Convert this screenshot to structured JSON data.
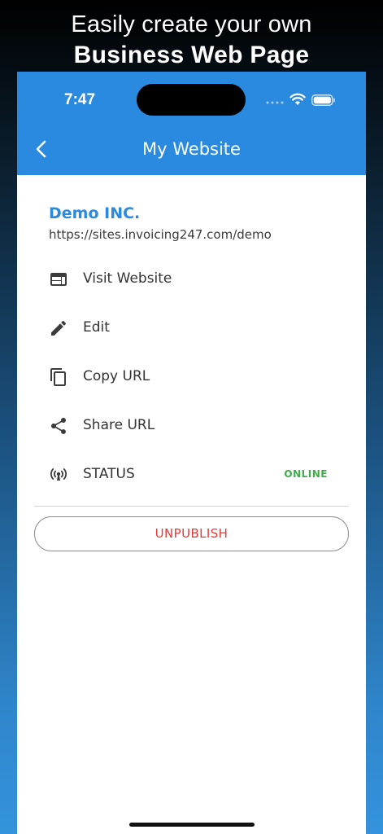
{
  "promo": {
    "line1": "Easily create your own",
    "line2": "Business Web Page"
  },
  "status_bar": {
    "time": "7:47",
    "icons": [
      "signal-icon",
      "wifi-icon",
      "battery-icon"
    ]
  },
  "header": {
    "title": "My Website",
    "back_icon": "chevron-left-icon"
  },
  "business": {
    "name": "Demo INC.",
    "url": "https://sites.invoicing247.com/demo"
  },
  "menu": {
    "items": [
      {
        "label": "Visit Website",
        "icon": "web-icon"
      },
      {
        "label": "Edit",
        "icon": "pencil-icon"
      },
      {
        "label": "Copy URL",
        "icon": "copy-icon"
      },
      {
        "label": "Share URL",
        "icon": "share-icon"
      },
      {
        "label": "STATUS",
        "icon": "broadcast-icon"
      }
    ],
    "status_value": "ONLINE"
  },
  "actions": {
    "unpublish_label": "UNPUBLISH"
  },
  "colors": {
    "primary": "#2a8ae0",
    "online": "#3dae4a",
    "danger": "#e53935"
  }
}
